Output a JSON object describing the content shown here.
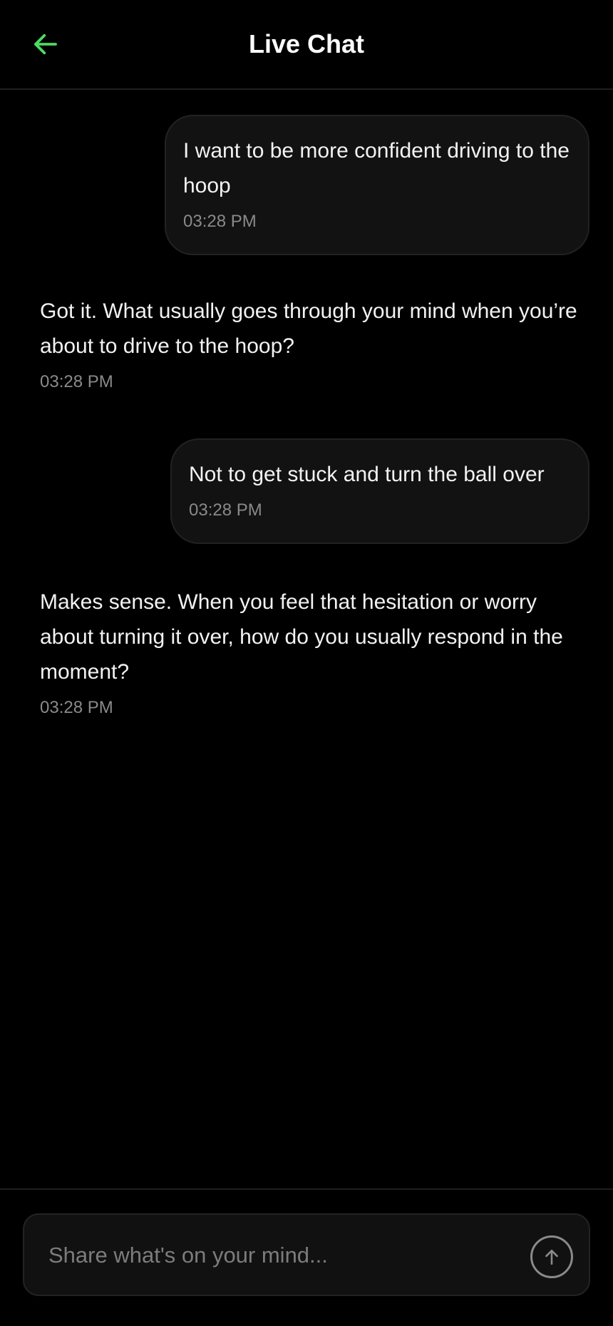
{
  "header": {
    "title": "Live Chat",
    "back_icon": "arrow-left-icon",
    "accent_color": "#4cd964"
  },
  "messages": [
    {
      "sender": "user",
      "text": "I want to be more confident driving to the hoop",
      "time": "03:28 PM"
    },
    {
      "sender": "bot",
      "text": "Got it. What usually goes through your mind when you’re about to drive to the hoop?",
      "time": "03:28 PM"
    },
    {
      "sender": "user",
      "text": "Not to get stuck and turn the ball over",
      "time": "03:28 PM"
    },
    {
      "sender": "bot",
      "text": "Makes sense. When you feel that hesitation or worry about turning it over, how do you usually respond in the moment?",
      "time": "03:28 PM"
    }
  ],
  "composer": {
    "placeholder": "Share what's on your mind...",
    "value": "",
    "send_icon": "arrow-up-icon"
  }
}
